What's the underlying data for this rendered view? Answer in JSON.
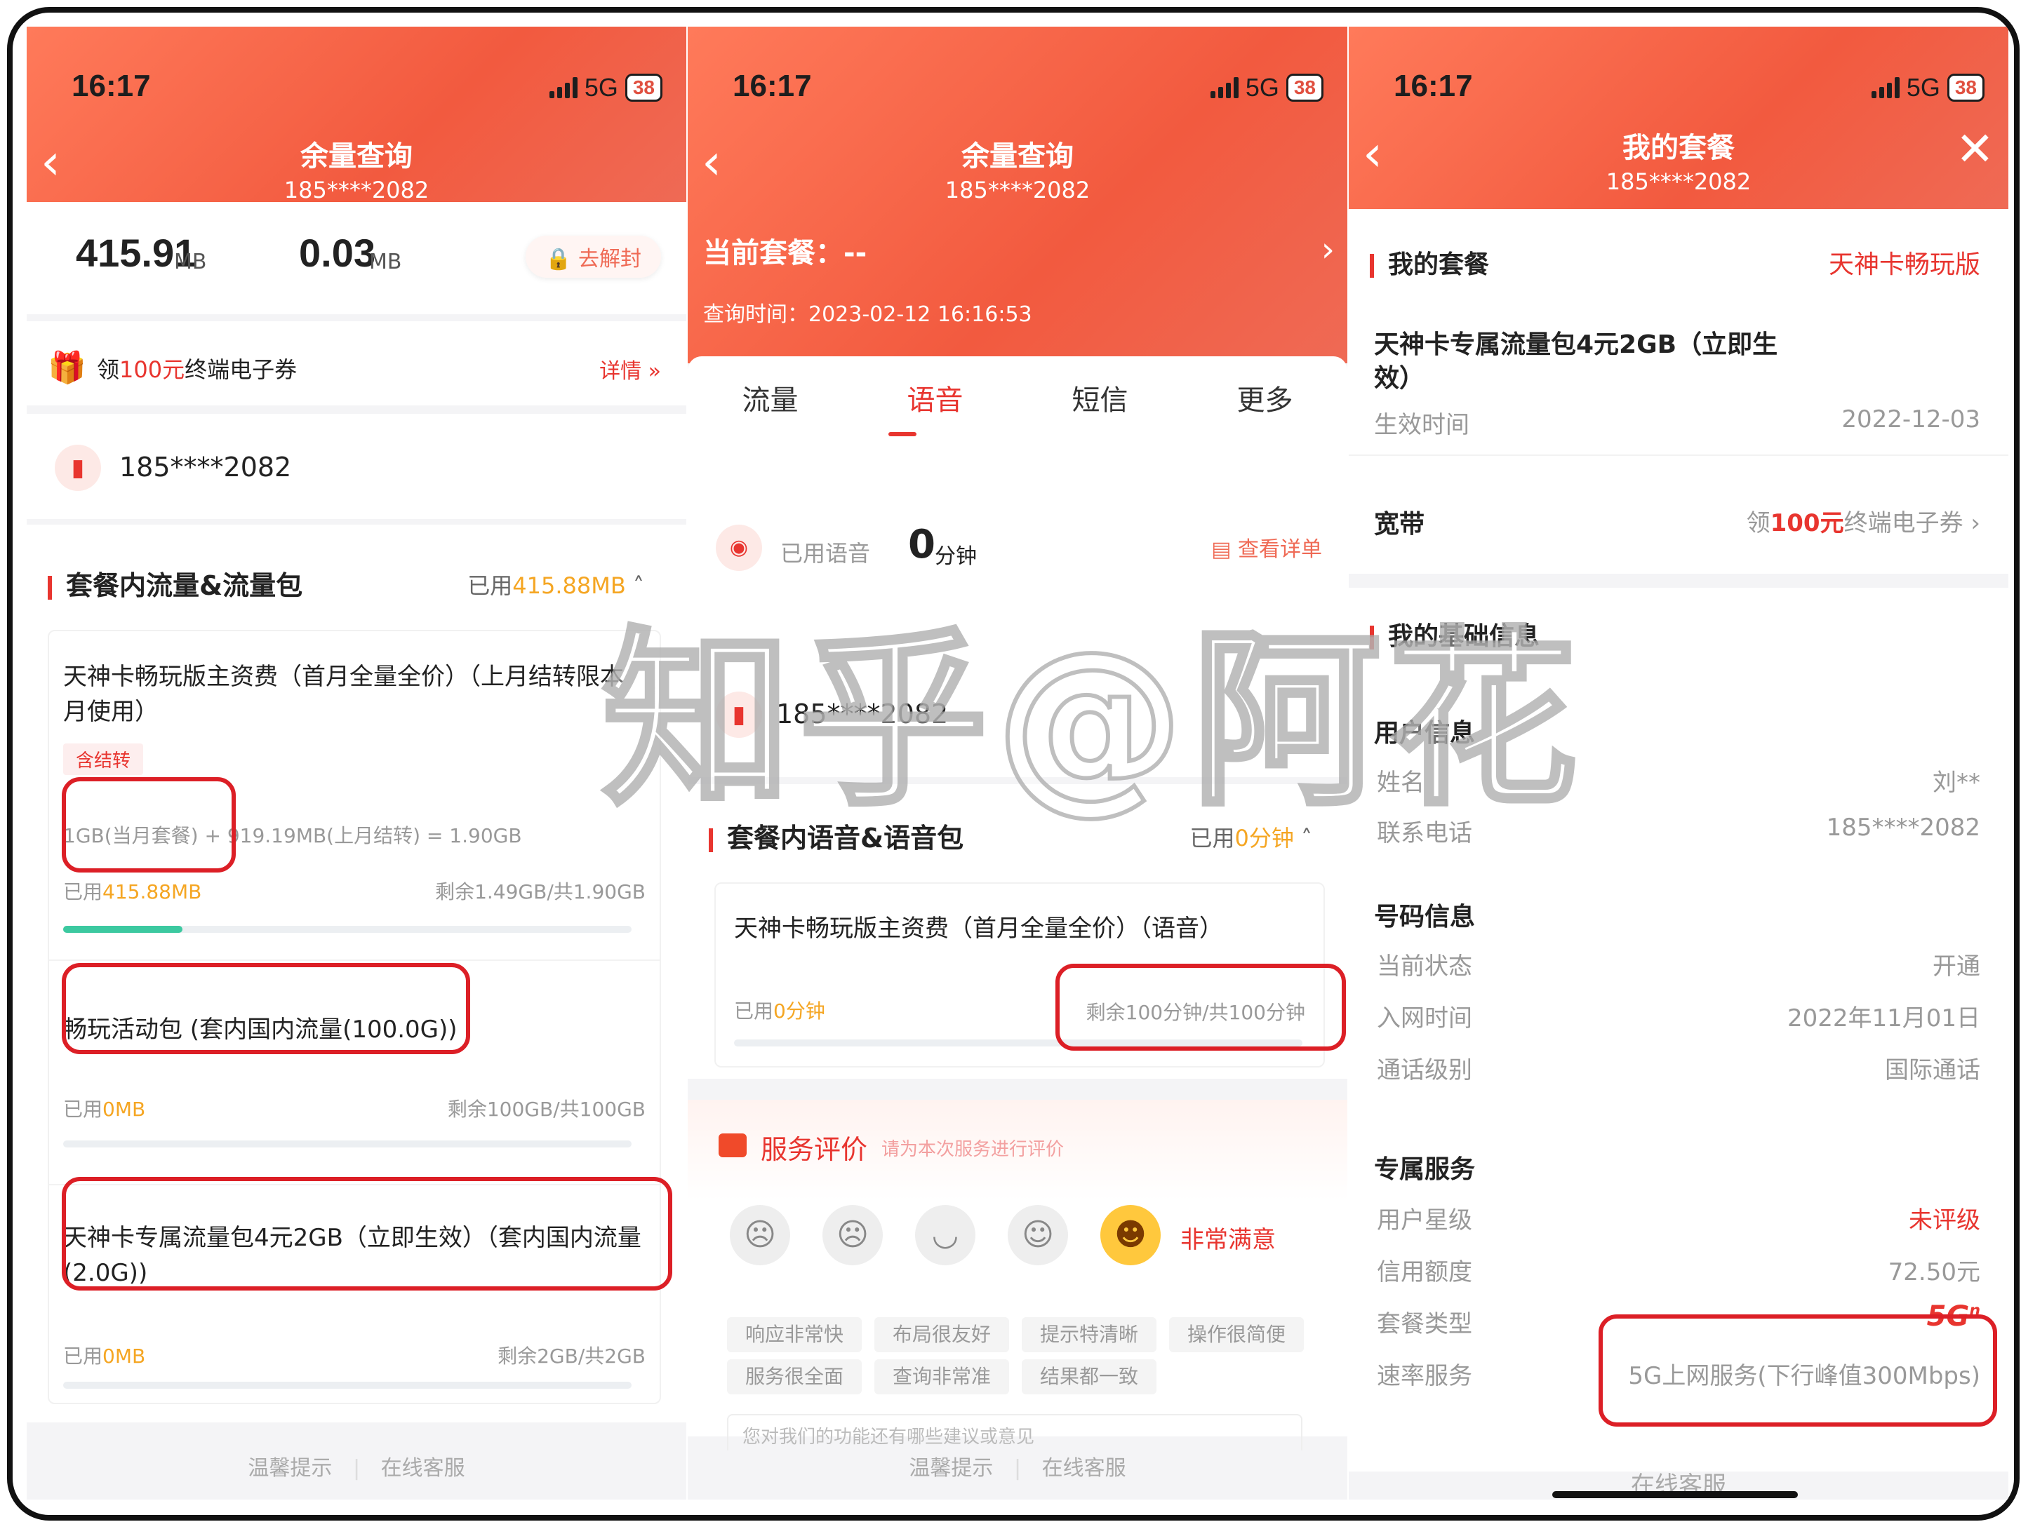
{
  "watermark": "知乎@阿花",
  "status": {
    "time": "16:17",
    "network": "5G",
    "battery": "38"
  },
  "panel1": {
    "title": "余量查询",
    "subtitle": "185****2082",
    "data_left": "415.91",
    "data_left_unit": "MB",
    "data_right": "0.03",
    "data_right_unit": "MB",
    "unlock_label": "去解封",
    "coupon_prefix": "领",
    "coupon_amount": "100元",
    "coupon_suffix": "终端电子券",
    "coupon_link": "详情 »",
    "phone": "185****2082",
    "section_title": "套餐内流量&流量包",
    "section_used_label": "已用",
    "section_used_value": "415.88MB",
    "item1": {
      "title": "天神卡畅玩版主资费（首月全量全价）（上月结转限本月使用）",
      "tag": "含结转",
      "formula_a": "1GB(当月套餐)",
      "formula_b": " + 919.19MB(上月结转) = 1.90GB",
      "used_label": "已用",
      "used_value": "415.88MB",
      "remain": "剩余1.49GB/共1.90GB",
      "progress": 0.21
    },
    "item2": {
      "title": "畅玩活动包 (套内国内流量(100.0G))",
      "used_label": "已用",
      "used_value": "0MB",
      "remain": "剩余100GB/共100GB"
    },
    "item3": {
      "title": "天神卡专属流量包4元2GB（立即生效）（套内国内流量(2.0G))",
      "used_label": "已用",
      "used_value": "0MB",
      "remain": "剩余2GB/共2GB"
    },
    "footer_left": "温馨提示",
    "footer_right": "在线客服"
  },
  "panel2": {
    "title": "余量查询",
    "subtitle": "185****2082",
    "plan_label": "当前套餐：",
    "plan_value": "--",
    "query_time": "查询时间：2023-02-12 16:16:53",
    "tabs": [
      "流量",
      "语音",
      "短信",
      "更多"
    ],
    "active_tab": 1,
    "voice_used_label": "已用语音",
    "voice_used_value": "0",
    "voice_used_unit": "分钟",
    "detail_link": "查看详单",
    "phone": "185****2082",
    "section_title": "套餐内语音&语音包",
    "section_used_label": "已用",
    "section_used_value": "0分钟",
    "item1": {
      "title": "天神卡畅玩版主资费（首月全量全价）（语音）",
      "used_label": "已用",
      "used_value": "0分钟",
      "remain": "剩余100分钟/共100分钟"
    },
    "rating_title": "服务评价",
    "rating_hint": "请为本次服务进行评价",
    "rating_selected": "非常满意",
    "rating_tags": [
      "响应非常快",
      "布局很友好",
      "提示特清晰",
      "操作很简便",
      "服务很全面",
      "查询非常准",
      "结果都一致"
    ],
    "feedback_placeholder": "您对我们的功能还有哪些建议或意见",
    "footer_left": "温馨提示",
    "footer_right": "在线客服"
  },
  "panel3": {
    "title": "我的套餐",
    "subtitle": "185****2082",
    "my_plan_label": "我的套餐",
    "my_plan_value": "天神卡畅玩版",
    "package_name": "天神卡专属流量包4元2GB（立即生效）",
    "effective_label": "生效时间",
    "effective_value": "2022-12-03",
    "broadband_label": "宽带",
    "broadband_prefix": "领",
    "broadband_amount": "100元",
    "broadband_suffix": "终端电子券 ›",
    "basic_info_label": "我的基础信息",
    "user_info_title": "用户信息",
    "name_label": "姓名",
    "name_value": "刘**",
    "contact_label": "联系电话",
    "contact_value": "185****2082",
    "number_info_title": "号码信息",
    "state_label": "当前状态",
    "state_value": "开通",
    "join_label": "入网时间",
    "join_value": "2022年11月01日",
    "call_label": "通话级别",
    "call_value": "国际通话",
    "service_title": "专属服务",
    "star_label": "用户星级",
    "star_value": "未评级",
    "credit_label": "信用额度",
    "credit_value": "72.50元",
    "plan_type_label": "套餐类型",
    "plan_type_value": "5G",
    "plan_type_sup": "n",
    "speed_label": "速率服务",
    "speed_value": "5G上网服务(下行峰值300Mbps)",
    "footer": "在线客服"
  }
}
